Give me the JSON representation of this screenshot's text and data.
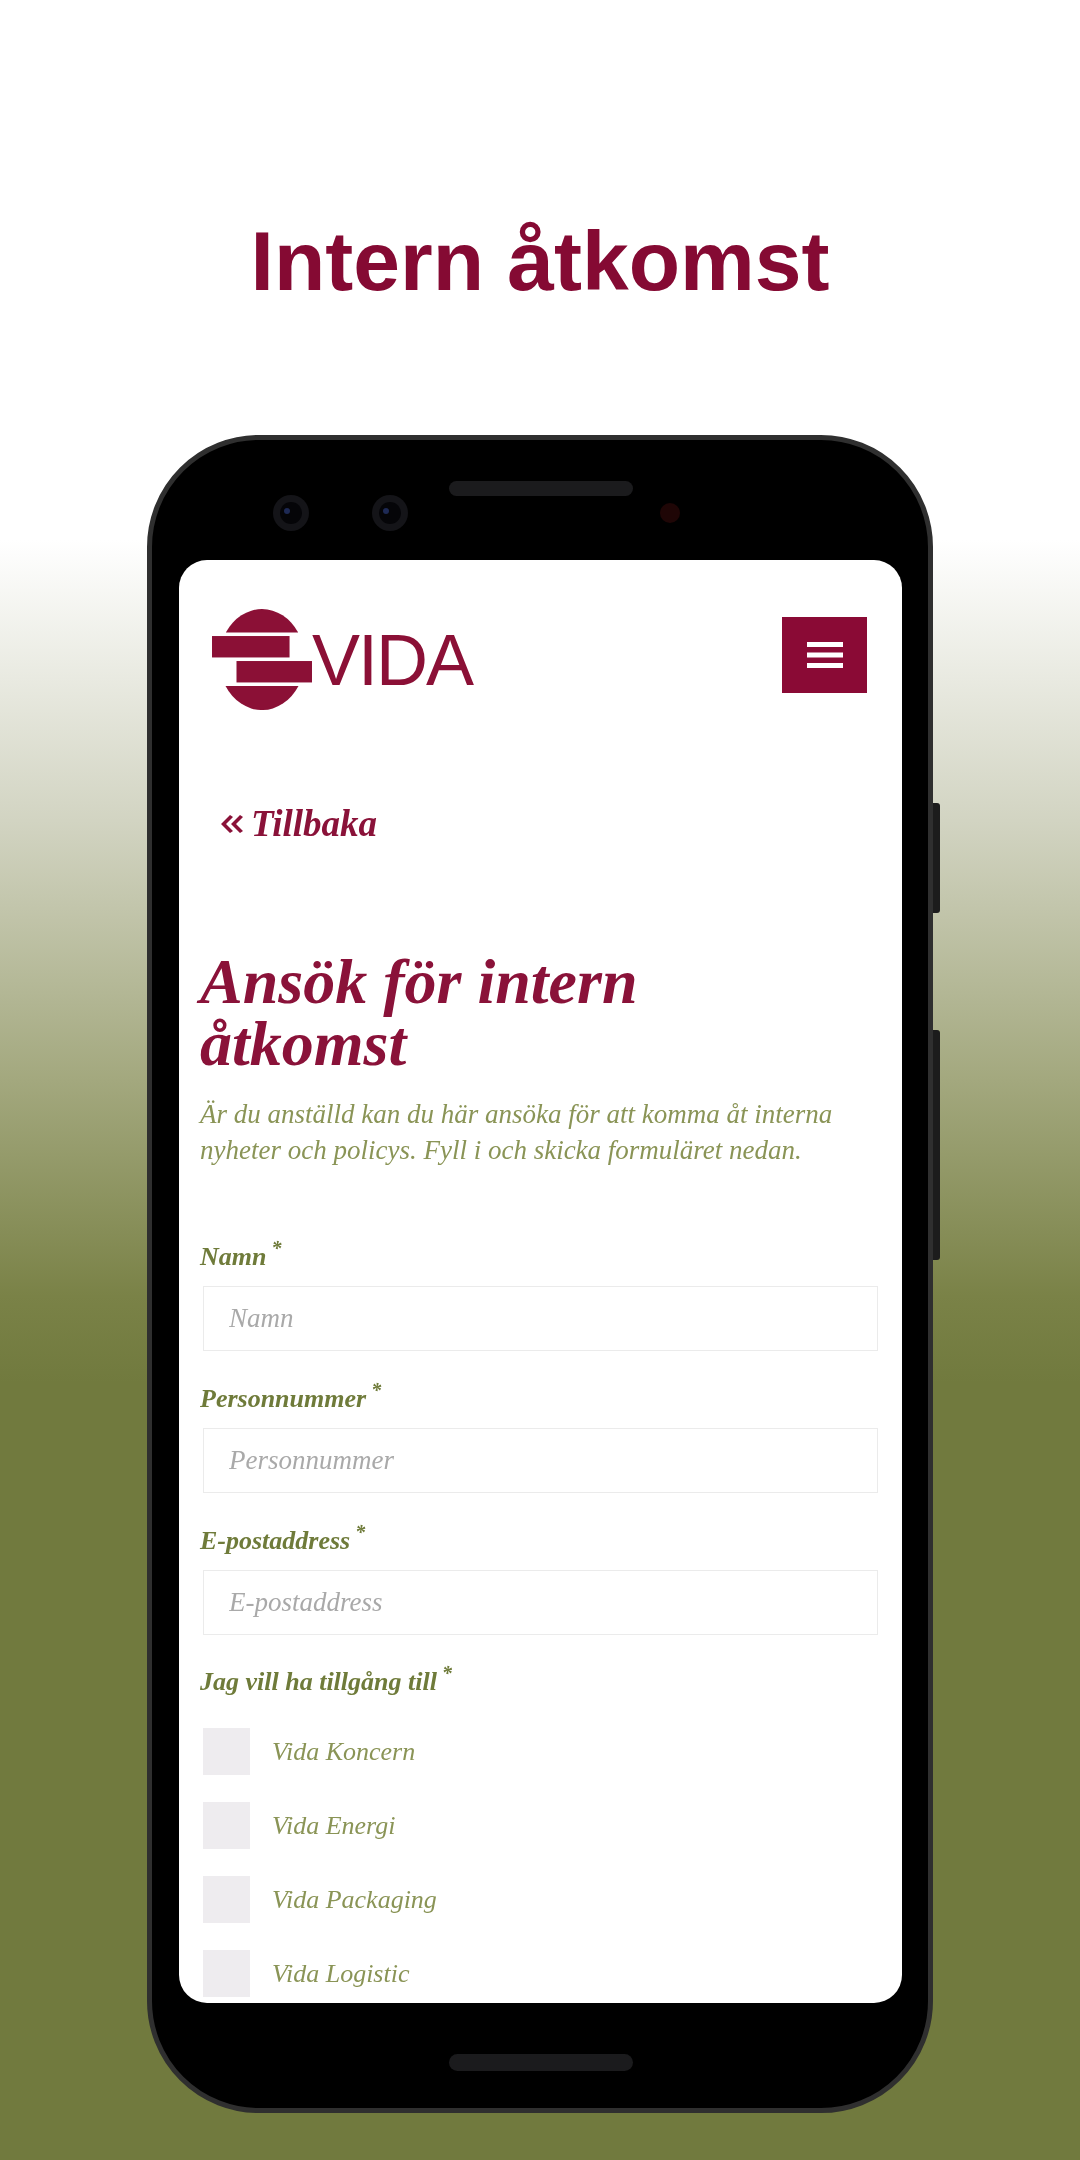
{
  "promo_title": "Intern åtkomst",
  "site_header": {
    "logo_text": "VIDA"
  },
  "back_link": {
    "label": "Tillbaka"
  },
  "heading": "Ansök för intern åtkomst",
  "intro": "Är du anställd kan du här ansöka för att komma åt interna nyheter och policys. Fyll i och skicka formuläret nedan.",
  "fields": [
    {
      "label": "Namn$^{*}$",
      "placeholder": "Namn"
    },
    {
      "label": "Personnummer$^{*}$",
      "placeholder": "Personnummer"
    },
    {
      "label": "E-postaddress$^{*}$",
      "placeholder": "E-postaddress"
    }
  ],
  "access_group": {
    "label": "Jag vill ha tillgång till$^{*}$",
    "options": [
      {
        "label": "Vida Koncern",
        "checked": false
      },
      {
        "label": "Vida Energi",
        "checked": false
      },
      {
        "label": "Vida Packaging",
        "checked": false
      },
      {
        "label": "Vida Logistic",
        "checked": false
      }
    ]
  }
}
